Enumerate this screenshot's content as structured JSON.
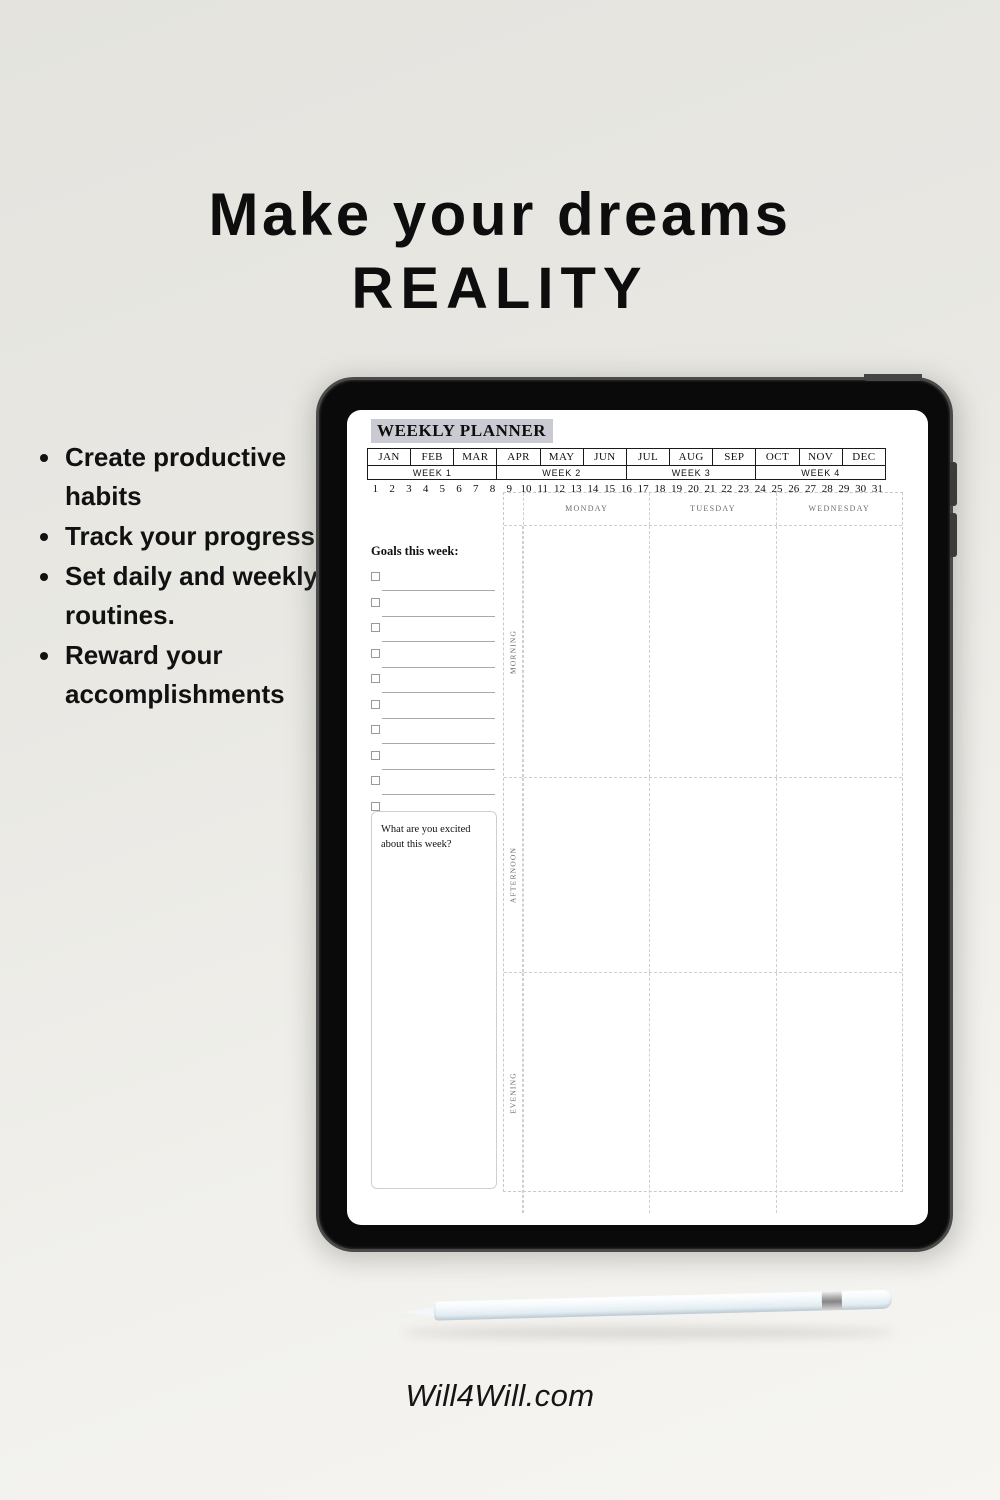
{
  "background": {
    "color_top": "#e4e3de",
    "color_bottom": "#f6f5f1"
  },
  "headline": {
    "line1": "Make your dreams",
    "line2": "REALITY"
  },
  "features": [
    "Create productive habits",
    "Track your progress",
    "Set daily and weekly routines.",
    "Reward your accomplishments"
  ],
  "device": {
    "type": "tablet",
    "frame_color": "#0a0a0a",
    "camera_dots": 3
  },
  "planner": {
    "title": "WEEKLY PLANNER",
    "title_highlight_color": "#c9cad2",
    "months": [
      "JAN",
      "FEB",
      "MAR",
      "APR",
      "MAY",
      "JUN",
      "JUL",
      "AUG",
      "SEP",
      "OCT",
      "NOV",
      "DEC"
    ],
    "weeks": [
      "WEEK 1",
      "WEEK 2",
      "WEEK 3",
      "WEEK 4"
    ],
    "days": [
      "1",
      "2",
      "3",
      "4",
      "5",
      "6",
      "7",
      "8",
      "9",
      "10",
      "11",
      "12",
      "13",
      "14",
      "15",
      "16",
      "17",
      "18",
      "19",
      "20",
      "21",
      "22",
      "23",
      "24",
      "25",
      "26",
      "27",
      "28",
      "29",
      "30",
      "31"
    ],
    "goals": {
      "title": "Goals this week:",
      "row_count": 10
    },
    "prompt": {
      "text": "What are you excited about this week?"
    },
    "day_columns": [
      "MONDAY",
      "TUESDAY",
      "WEDNESDAY"
    ],
    "time_blocks": [
      "MORNING",
      "AFTERNOON",
      "EVENING"
    ]
  },
  "stylus": {
    "present": true,
    "color": "#f2f7fa"
  },
  "footer": {
    "site": "Will4Will.com"
  }
}
